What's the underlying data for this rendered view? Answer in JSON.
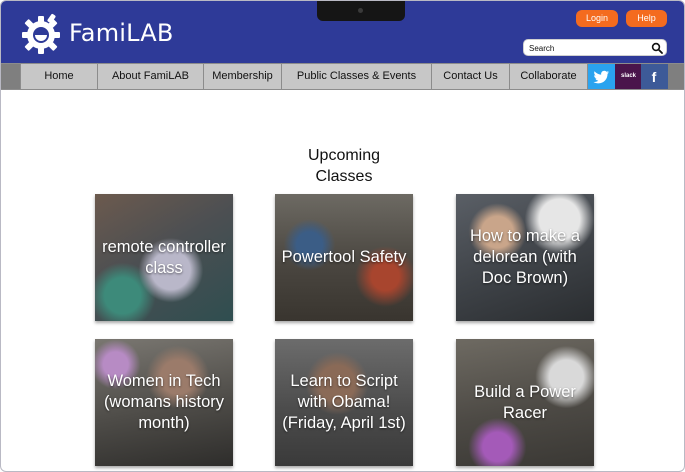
{
  "header": {
    "site_title": "FamiLAB",
    "login_label": "Login",
    "help_label": "Help",
    "search_placeholder": "Search"
  },
  "nav": {
    "items": [
      {
        "label": "Home"
      },
      {
        "label": "About FamiLAB"
      },
      {
        "label": "Membership"
      },
      {
        "label": "Public Classes & Events"
      },
      {
        "label": "Contact Us"
      },
      {
        "label": "Collaborate"
      }
    ],
    "social": [
      {
        "name": "twitter-icon"
      },
      {
        "name": "slack-icon",
        "text": "slack"
      },
      {
        "name": "facebook-icon",
        "text": "f"
      }
    ]
  },
  "main": {
    "section_title": "Upcoming Classes",
    "classes": [
      {
        "title": "remote controller class"
      },
      {
        "title": "Powertool Safety"
      },
      {
        "title": "How to make a delorean (with Doc Brown)"
      },
      {
        "title": "Women in Tech (womans history month)"
      },
      {
        "title": "Learn to Script with Obama! (Friday, April 1st)"
      },
      {
        "title": "Build a Power Racer"
      }
    ]
  },
  "colors": {
    "header_bg": "#2e3a98",
    "accent_orange": "#f46b1f",
    "nav_bg": "#c7c7c7",
    "twitter": "#2aa3ef",
    "slack": "#4a154b",
    "facebook": "#3d5a98"
  }
}
